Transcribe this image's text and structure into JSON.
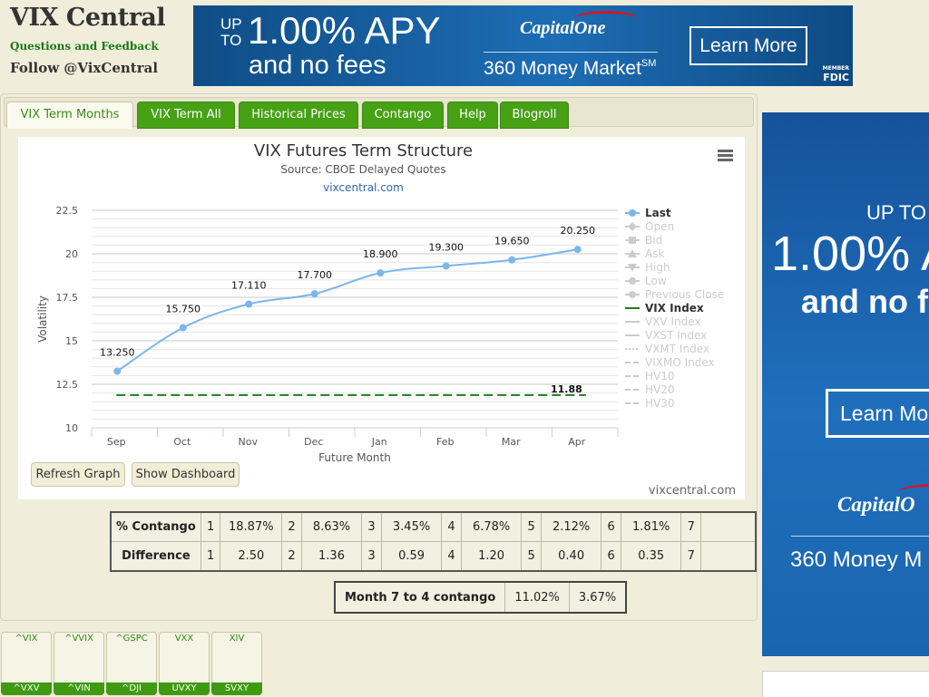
{
  "header": {
    "site_title": "VIX Central",
    "questions_link": "Questions and Feedback",
    "follow_link": "Follow @VixCentral"
  },
  "banner_ad": {
    "up_to": "UP TO",
    "rate": "1.00% APY",
    "no_fees": "and no fees",
    "brand": "CapitalOne",
    "product": "360 Money Market",
    "product_sup": "SM",
    "cta": "Learn More",
    "fdic_top": "MEMBER",
    "fdic": "FDIC"
  },
  "tabs": [
    {
      "label": "VIX Term Months",
      "active": true
    },
    {
      "label": "VIX Term All",
      "active": false
    },
    {
      "label": "Historical Prices",
      "active": false
    },
    {
      "label": "Contango",
      "active": false
    },
    {
      "label": "Help",
      "active": false
    },
    {
      "label": "Blogroll",
      "active": false
    }
  ],
  "chart_data": {
    "type": "line",
    "title": "VIX Futures Term Structure",
    "subtitle": "Source: CBOE Delayed Quotes",
    "link": "vixcentral.com",
    "credit": "vixcentral.com",
    "xlabel": "Future Month",
    "ylabel": "Volatility",
    "categories": [
      "Sep",
      "Oct",
      "Nov",
      "Dec",
      "Jan",
      "Feb",
      "Mar",
      "Apr"
    ],
    "ylim": [
      10,
      22.5
    ],
    "yticks": [
      "10",
      "12.5",
      "15",
      "17.5",
      "20",
      "22.5"
    ],
    "series": [
      {
        "name": "Last",
        "values": [
          13.25,
          15.75,
          17.11,
          17.7,
          18.9,
          19.3,
          19.65,
          20.25
        ],
        "labels": [
          "13.250",
          "15.750",
          "17.110",
          "17.700",
          "18.900",
          "19.300",
          "19.650",
          "20.250"
        ],
        "color": "#7cb5ec"
      },
      {
        "name": "VIX Index",
        "value": 11.88,
        "label": "11.88",
        "color": "#1e7d1e",
        "dashed": true
      }
    ],
    "legend_position": "right",
    "legend": [
      {
        "name": "Last",
        "active": true,
        "symbol": "circle"
      },
      {
        "name": "Open",
        "active": false,
        "symbol": "diamond"
      },
      {
        "name": "Bid",
        "active": false,
        "symbol": "square"
      },
      {
        "name": "Ask",
        "active": false,
        "symbol": "triangle"
      },
      {
        "name": "High",
        "active": false,
        "symbol": "triangle-down"
      },
      {
        "name": "Low",
        "active": false,
        "symbol": "circle"
      },
      {
        "name": "Previous Close",
        "active": false,
        "symbol": "circle"
      },
      {
        "name": "VIX Index",
        "active": true,
        "symbol": "line"
      },
      {
        "name": "VXV Index",
        "active": false,
        "symbol": "line"
      },
      {
        "name": "VXST Index",
        "active": false,
        "symbol": "line"
      },
      {
        "name": "VXMT Index",
        "active": false,
        "symbol": "dot"
      },
      {
        "name": "VIXMO Index",
        "active": false,
        "symbol": "dash"
      },
      {
        "name": "HV10",
        "active": false,
        "symbol": "dash"
      },
      {
        "name": "HV20",
        "active": false,
        "symbol": "dash"
      },
      {
        "name": "HV30",
        "active": false,
        "symbol": "dash"
      }
    ],
    "grid": true
  },
  "buttons": {
    "refresh": "Refresh Graph",
    "dashboard": "Show Dashboard"
  },
  "contango_table": {
    "rows": [
      {
        "label": "% Contango",
        "cells": [
          [
            "1",
            "18.87%"
          ],
          [
            "2",
            "8.63%"
          ],
          [
            "3",
            "3.45%"
          ],
          [
            "4",
            "6.78%"
          ],
          [
            "5",
            "2.12%"
          ],
          [
            "6",
            "1.81%"
          ],
          [
            "7",
            ""
          ]
        ]
      },
      {
        "label": "Difference",
        "cells": [
          [
            "1",
            "2.50"
          ],
          [
            "2",
            "1.36"
          ],
          [
            "3",
            "0.59"
          ],
          [
            "4",
            "1.20"
          ],
          [
            "5",
            "0.40"
          ],
          [
            "6",
            "0.35"
          ],
          [
            "7",
            ""
          ]
        ]
      }
    ]
  },
  "month_contango": {
    "label": "Month 7 to 4 contango",
    "value1": "11.02%",
    "value2": "3.67%"
  },
  "side_ad": {
    "up_to": "UP TO",
    "rate": "1.00% A",
    "no_fees": "and no f",
    "cta": "Learn Mo",
    "brand": "CapitalO",
    "product": "360 Money M"
  },
  "tickers": [
    {
      "top": "^VIX",
      "bottom": "^VXV"
    },
    {
      "top": "^VVIX",
      "bottom": "^VIN"
    },
    {
      "top": "^GSPC",
      "bottom": "^DJI"
    },
    {
      "top": "VXX",
      "bottom": "UVXY"
    },
    {
      "top": "XIV",
      "bottom": "SVXY"
    }
  ]
}
